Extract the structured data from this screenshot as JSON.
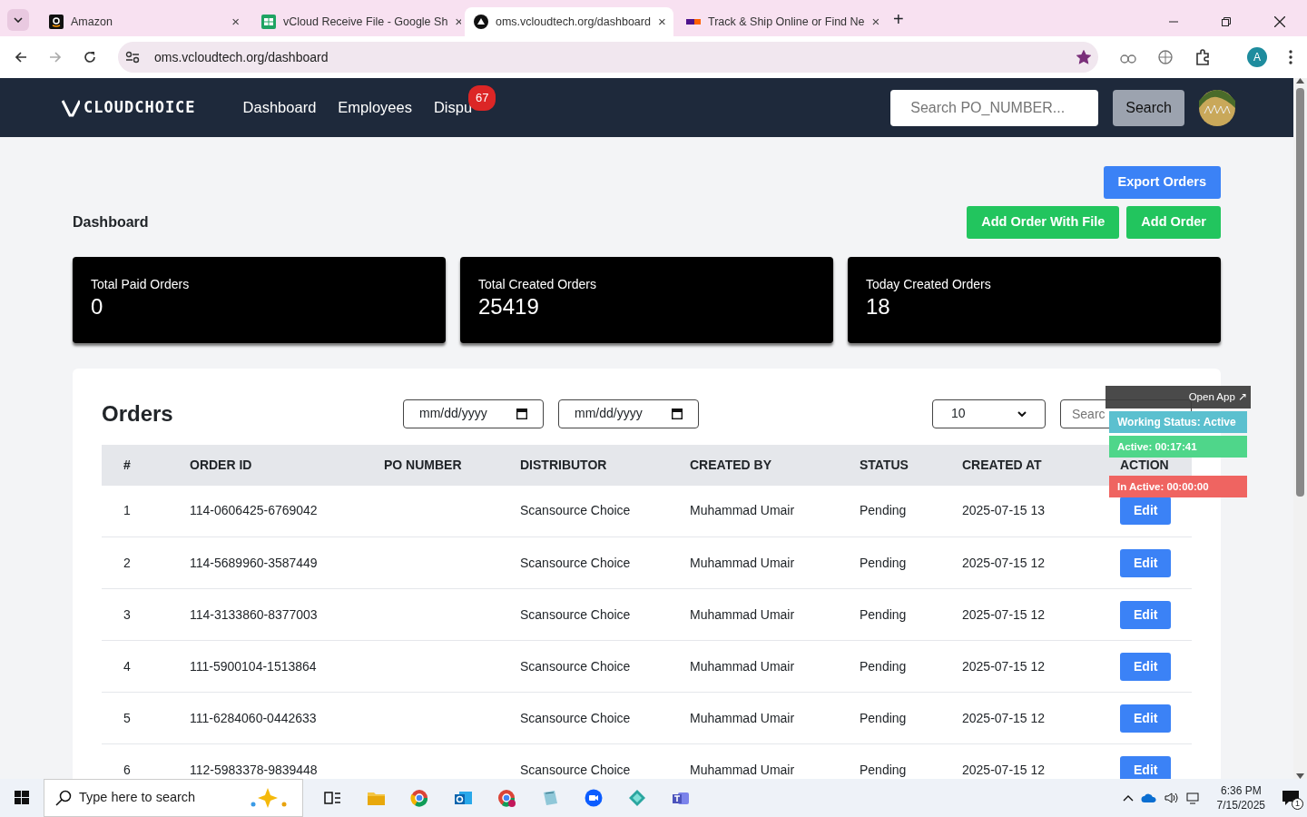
{
  "browser": {
    "tabs": [
      {
        "title": "Amazon",
        "close": "×",
        "selected": false
      },
      {
        "title": "vCloud Receive File - Google Sh",
        "close": "×",
        "selected": false
      },
      {
        "title": "oms.vcloudtech.org/dashboard",
        "close": "×",
        "selected": true
      },
      {
        "title": "Track & Ship Online or Find Ne",
        "close": "×",
        "selected": false
      }
    ],
    "new_tab": "+",
    "address": "oms.vcloudtech.org/dashboard",
    "bookmarked": true,
    "profile": "A"
  },
  "navbar": {
    "brand": "CLOUDCHOICE",
    "links": [
      {
        "label": "Dashboard"
      },
      {
        "label": "Employees"
      },
      {
        "label": "Dispu",
        "badge": "67"
      }
    ],
    "search": {
      "placeholder": "Search PO_NUMBER..."
    },
    "search_button": "Search"
  },
  "page": {
    "export_button": "Export Orders",
    "title": "Dashboard",
    "buttons": [
      "Add Order With File",
      "Add Order"
    ],
    "stats": [
      {
        "label": "Total Paid Orders",
        "value": "0"
      },
      {
        "label": "Total Created Orders",
        "value": "25419"
      },
      {
        "label": "Today Created Orders",
        "value": "18"
      }
    ]
  },
  "orders": {
    "title": "Orders",
    "date_from": {
      "placeholder": "mm/dd/yyyy"
    },
    "date_to": {
      "placeholder": "mm/dd/yyyy"
    },
    "page_size": "10",
    "search": {
      "placeholder": "Searc"
    },
    "columns": [
      "#",
      "ORDER ID",
      "PO NUMBER",
      "DISTRIBUTOR",
      "CREATED BY",
      "STATUS",
      "CREATED AT",
      "ACTION"
    ],
    "rows": [
      {
        "n": "1",
        "order_id": "114-0606425-6769042",
        "po": "",
        "distributor": "Scansource Choice",
        "created_by": "Muhammad Umair",
        "status": "Pending",
        "created_at": "2025-07-15 13",
        "action": "Edit"
      },
      {
        "n": "2",
        "order_id": "114-5689960-3587449",
        "po": "",
        "distributor": "Scansource Choice",
        "created_by": "Muhammad Umair",
        "status": "Pending",
        "created_at": "2025-07-15 12",
        "action": "Edit"
      },
      {
        "n": "3",
        "order_id": "114-3133860-8377003",
        "po": "",
        "distributor": "Scansource Choice",
        "created_by": "Muhammad Umair",
        "status": "Pending",
        "created_at": "2025-07-15 12",
        "action": "Edit"
      },
      {
        "n": "4",
        "order_id": "111-5900104-1513864",
        "po": "",
        "distributor": "Scansource Choice",
        "created_by": "Muhammad Umair",
        "status": "Pending",
        "created_at": "2025-07-15 12",
        "action": "Edit"
      },
      {
        "n": "5",
        "order_id": "111-6284060-0442633",
        "po": "",
        "distributor": "Scansource Choice",
        "created_by": "Muhammad Umair",
        "status": "Pending",
        "created_at": "2025-07-15 12",
        "action": "Edit"
      },
      {
        "n": "6",
        "order_id": "112-5983378-9839448",
        "po": "",
        "distributor": "Scansource Choice",
        "created_by": "Muhammad Umair",
        "status": "Pending",
        "created_at": "2025-07-15 12",
        "action": "Edit"
      }
    ]
  },
  "tracker": {
    "open_app": "Open App ↗",
    "items": [
      {
        "kind": "status",
        "text": "Working Status: Active",
        "color": "#5bc0cf"
      },
      {
        "kind": "timer",
        "text": "Active: 00:17:41",
        "color": "#4fd68a"
      },
      {
        "kind": "timer",
        "text": "In Active: 00:00:00",
        "color": "#ef6461"
      }
    ]
  },
  "taskbar": {
    "search": {
      "placeholder": "Type here to search"
    },
    "time": "6:36 PM",
    "date": "7/15/2025",
    "notifications": "1"
  }
}
